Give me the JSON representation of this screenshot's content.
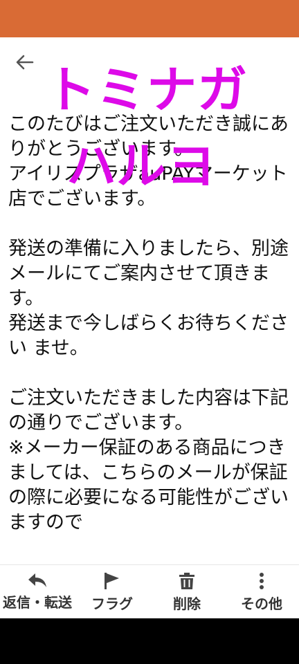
{
  "overlay": {
    "line1": "トミナガ",
    "line2": "ハルヨ",
    "color": "#dd0ae8"
  },
  "colors": {
    "status_bar": "#d96b35",
    "background": "#ffffff"
  },
  "header": {
    "back_icon": "arrow-left-icon"
  },
  "message": {
    "paragraphs": [
      "このたびはご注文いただき誠にありがとうございます。\nアイリスプラザauPAYマーケット店でございます。",
      "発送の準備に入りましたら、別途メールにてご案内させて頂きます。\n発送まで今しばらくお待ちください ませ。",
      "ご注文いただきました内容は下記の通りでございます。\n※メーカー保証のある商品につきましては、こちらのメールが保証の際に必要になる可能性がございますので"
    ]
  },
  "bottom_bar": {
    "items": [
      {
        "label": "返信・転送",
        "icon": "reply-icon"
      },
      {
        "label": "フラグ",
        "icon": "flag-icon"
      },
      {
        "label": "削除",
        "icon": "trash-icon"
      },
      {
        "label": "その他",
        "icon": "more-vertical-icon"
      }
    ]
  }
}
